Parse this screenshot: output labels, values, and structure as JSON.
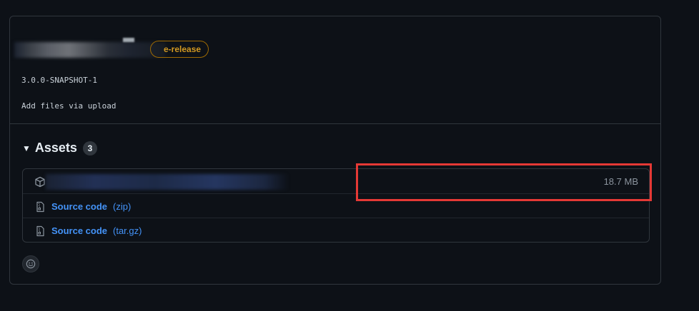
{
  "release": {
    "badge_label": "e-release",
    "version_text": "3.0.0-SNAPSHOT-1",
    "description": "Add files via upload"
  },
  "assets": {
    "title": "Assets",
    "count": "3",
    "items": [
      {
        "icon": "package-icon",
        "name_redacted": true,
        "size": "18.7 MB"
      },
      {
        "icon": "file-zip-icon",
        "label": "Source code",
        "format": "(zip)"
      },
      {
        "icon": "file-zip-icon",
        "label": "Source code",
        "format": "(tar.gz)"
      }
    ]
  },
  "reactions": {
    "icon": "smiley-icon"
  },
  "colors": {
    "background": "#0d1117",
    "border": "#30363d",
    "link": "#4493f8",
    "badge_warning": "#d29922",
    "highlight": "#e53935",
    "muted_text": "#8b949e"
  }
}
